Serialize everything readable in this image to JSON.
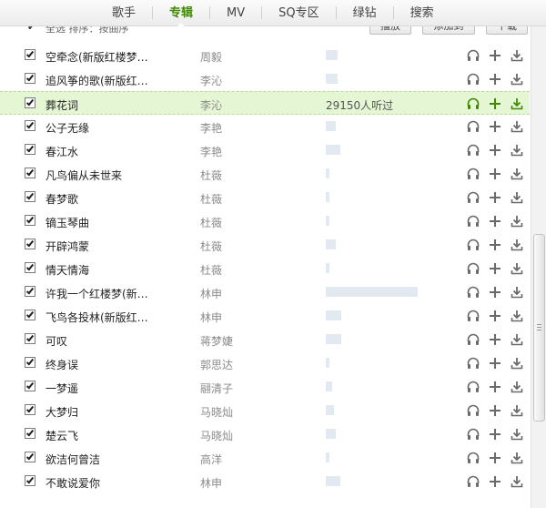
{
  "nav": {
    "tabs": [
      {
        "label": "歌手",
        "active": false
      },
      {
        "label": "专辑",
        "active": true
      },
      {
        "label": "MV",
        "active": false
      },
      {
        "label": "SQ专区",
        "active": false
      },
      {
        "label": "绿钻",
        "active": false
      },
      {
        "label": "搜索",
        "active": false
      }
    ]
  },
  "toolbar": {
    "select_all_label": "全选",
    "sort_label": "排序：按曲序",
    "play_label": "播放",
    "add_to_list_label": "添加到",
    "download_label": "下载"
  },
  "colors": {
    "accent": "#3f8a00",
    "selected_row_bg": "#e5f6d4",
    "popularity_bar": "#e2e9f0",
    "icon_gray": "#6a6a6a",
    "icon_green": "#3f8a00"
  },
  "songs": [
    {
      "title": "空牵念(新版红楼梦…",
      "artist": "周毅",
      "popularity": 0.1,
      "checked": true,
      "selected": false
    },
    {
      "title": "追风筝的歌(新版红…",
      "artist": "李沁",
      "popularity": 0.1,
      "checked": true,
      "selected": false
    },
    {
      "title": "葬花词",
      "artist": "李沁",
      "popularity": 0.0,
      "checked": true,
      "selected": true,
      "listen_text": "29150人听过"
    },
    {
      "title": "公子无缘",
      "artist": "李艳",
      "popularity": 0.08,
      "checked": true,
      "selected": false
    },
    {
      "title": "春江水",
      "artist": "李艳",
      "popularity": 0.12,
      "checked": true,
      "selected": false
    },
    {
      "title": "凡鸟偏从未世来",
      "artist": "杜薇",
      "popularity": 0.03,
      "checked": true,
      "selected": false
    },
    {
      "title": "春梦歌",
      "artist": "杜薇",
      "popularity": 0.03,
      "checked": true,
      "selected": false
    },
    {
      "title": "镝玉琴曲",
      "artist": "杜薇",
      "popularity": 0.03,
      "checked": true,
      "selected": false
    },
    {
      "title": "开辟鸿蒙",
      "artist": "杜薇",
      "popularity": 0.08,
      "checked": true,
      "selected": false
    },
    {
      "title": "情天情海",
      "artist": "杜薇",
      "popularity": 0.03,
      "checked": true,
      "selected": false
    },
    {
      "title": "许我一个红楼梦(新…",
      "artist": "林申",
      "popularity": 0.75,
      "checked": true,
      "selected": false
    },
    {
      "title": "飞鸟各投林(新版红…",
      "artist": "林申",
      "popularity": 0.13,
      "checked": true,
      "selected": false
    },
    {
      "title": "可叹",
      "artist": "蒋梦婕",
      "popularity": 0.13,
      "checked": true,
      "selected": false
    },
    {
      "title": "终身误",
      "artist": "郭思达",
      "popularity": 0.03,
      "checked": true,
      "selected": false
    },
    {
      "title": "一梦遥",
      "artist": "翮清子",
      "popularity": 0.05,
      "checked": true,
      "selected": false
    },
    {
      "title": "大梦归",
      "artist": "马晓灿",
      "popularity": 0.07,
      "checked": true,
      "selected": false
    },
    {
      "title": "楚云飞",
      "artist": "马晓灿",
      "popularity": 0.08,
      "checked": true,
      "selected": false
    },
    {
      "title": "欲洁何曾洁",
      "artist": "高洋",
      "popularity": 0.03,
      "checked": true,
      "selected": false
    },
    {
      "title": "不敢说爱你",
      "artist": "林申",
      "popularity": 0.12,
      "checked": true,
      "selected": false
    }
  ]
}
